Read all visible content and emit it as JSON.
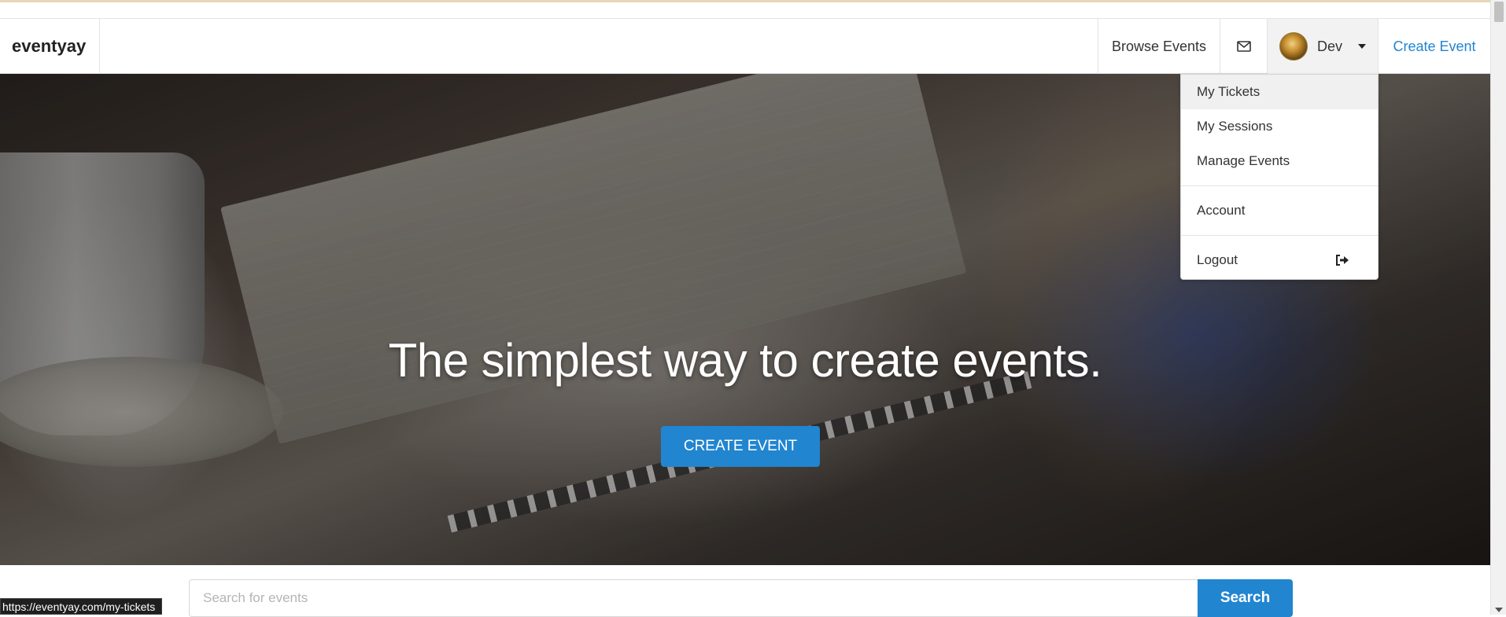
{
  "brand": {
    "name": "eventyay"
  },
  "nav": {
    "browse_label": "Browse Events",
    "user_name": "Dev",
    "create_label": "Create Event"
  },
  "dropdown": {
    "items": [
      {
        "label": "My Tickets",
        "active": true
      },
      {
        "label": "My Sessions"
      },
      {
        "label": "Manage Events"
      },
      {
        "label": "Account"
      },
      {
        "label": "Logout",
        "icon": "logout-icon"
      }
    ]
  },
  "hero": {
    "title": "The simplest way to create events.",
    "button_label": "CREATE EVENT"
  },
  "search": {
    "placeholder": "Search for events",
    "value": "",
    "button_label": "Search"
  },
  "status_bar": {
    "url": "https://eventyay.com/my-tickets"
  },
  "colors": {
    "accent": "#2185d0",
    "menu_active_bg": "#f0f0f0"
  },
  "icons": {
    "mail": "envelope-icon",
    "avatar": "user-avatar",
    "caret": "caret-down-icon",
    "logout": "sign-out-icon"
  }
}
